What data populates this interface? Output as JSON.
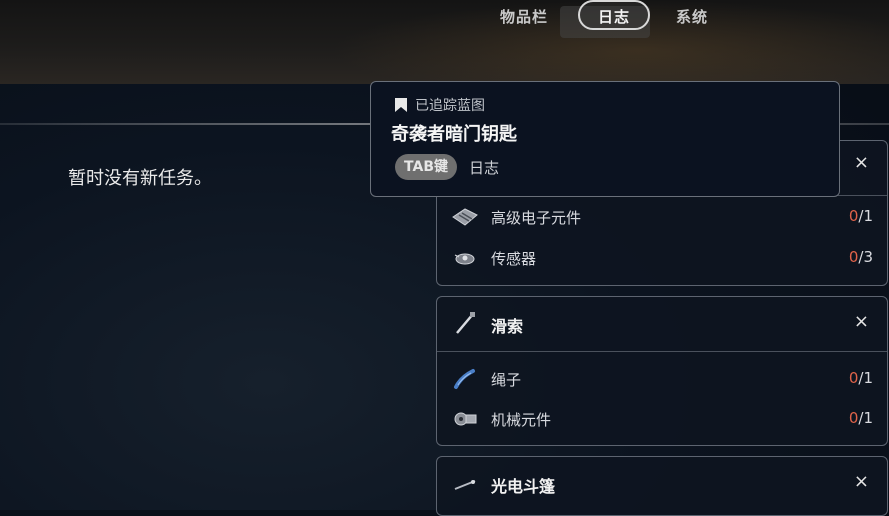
{
  "tabs": {
    "inventory": "物品栏",
    "log": "日志",
    "system": "系统"
  },
  "quests": {
    "empty_message": "暂时没有新任务。"
  },
  "tracker": {
    "label": "已追踪蓝图",
    "title": "奇袭者暗门钥匙",
    "key": "TAB键",
    "key_label": "日志"
  },
  "blueprints": [
    {
      "title": "",
      "close": "×",
      "materials": [
        {
          "name": "高级电子元件",
          "have": "0",
          "need": "/1",
          "icon": "circuit-board-icon"
        },
        {
          "name": "传感器",
          "have": "0",
          "need": "/3",
          "icon": "sensor-icon"
        }
      ]
    },
    {
      "title": "滑索",
      "icon": "zipline-icon",
      "close": "×",
      "materials": [
        {
          "name": "绳子",
          "have": "0",
          "need": "/1",
          "icon": "rope-icon"
        },
        {
          "name": "机械元件",
          "have": "0",
          "need": "/1",
          "icon": "mechanical-parts-icon"
        }
      ]
    },
    {
      "title": "光电斗篷",
      "icon": "cloak-icon",
      "close": "×",
      "materials": []
    }
  ],
  "colors": {
    "missing_count": "#e0634a",
    "panel_border": "#5d6470",
    "background": "#0c1420"
  }
}
